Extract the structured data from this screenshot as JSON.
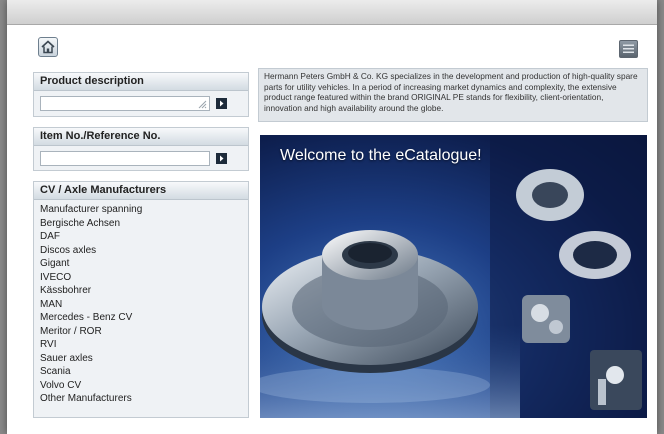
{
  "product_description": {
    "title": "Product description",
    "value": ""
  },
  "item_number": {
    "title": "Item No./Reference No.",
    "value": ""
  },
  "manufacturers": {
    "title": "CV / Axle Manufacturers",
    "items": [
      "Manufacturer spanning",
      "Bergische Achsen",
      "DAF",
      "Discos axles",
      "Gigant",
      "IVECO",
      "Kässbohrer",
      "MAN",
      "Mercedes - Benz CV",
      "Meritor / ROR",
      "RVI",
      "Sauer axles",
      "Scania",
      "Volvo CV",
      "Other Manufacturers"
    ]
  },
  "intro_text": "Hermann Peters GmbH & Co. KG specializes in the development and production of high-quality spare parts for utility vehicles. In a period of increasing market dynamics and complexity, the extensive product range featured within the brand ORIGINAL PE stands for flexibility, client-orientation, innovation and high availability around the globe.",
  "banner": {
    "title": "Welcome to the eCatalogue!"
  },
  "icons": {
    "home": "home-icon",
    "menu": "menu-icon",
    "go": "arrow-right-icon"
  },
  "colors": {
    "panel_bg": "#eff2f5",
    "header_gradient_bottom": "#d3dbe2",
    "banner_dark": "#0d1e4d",
    "button_dark": "#1d2b3a"
  }
}
